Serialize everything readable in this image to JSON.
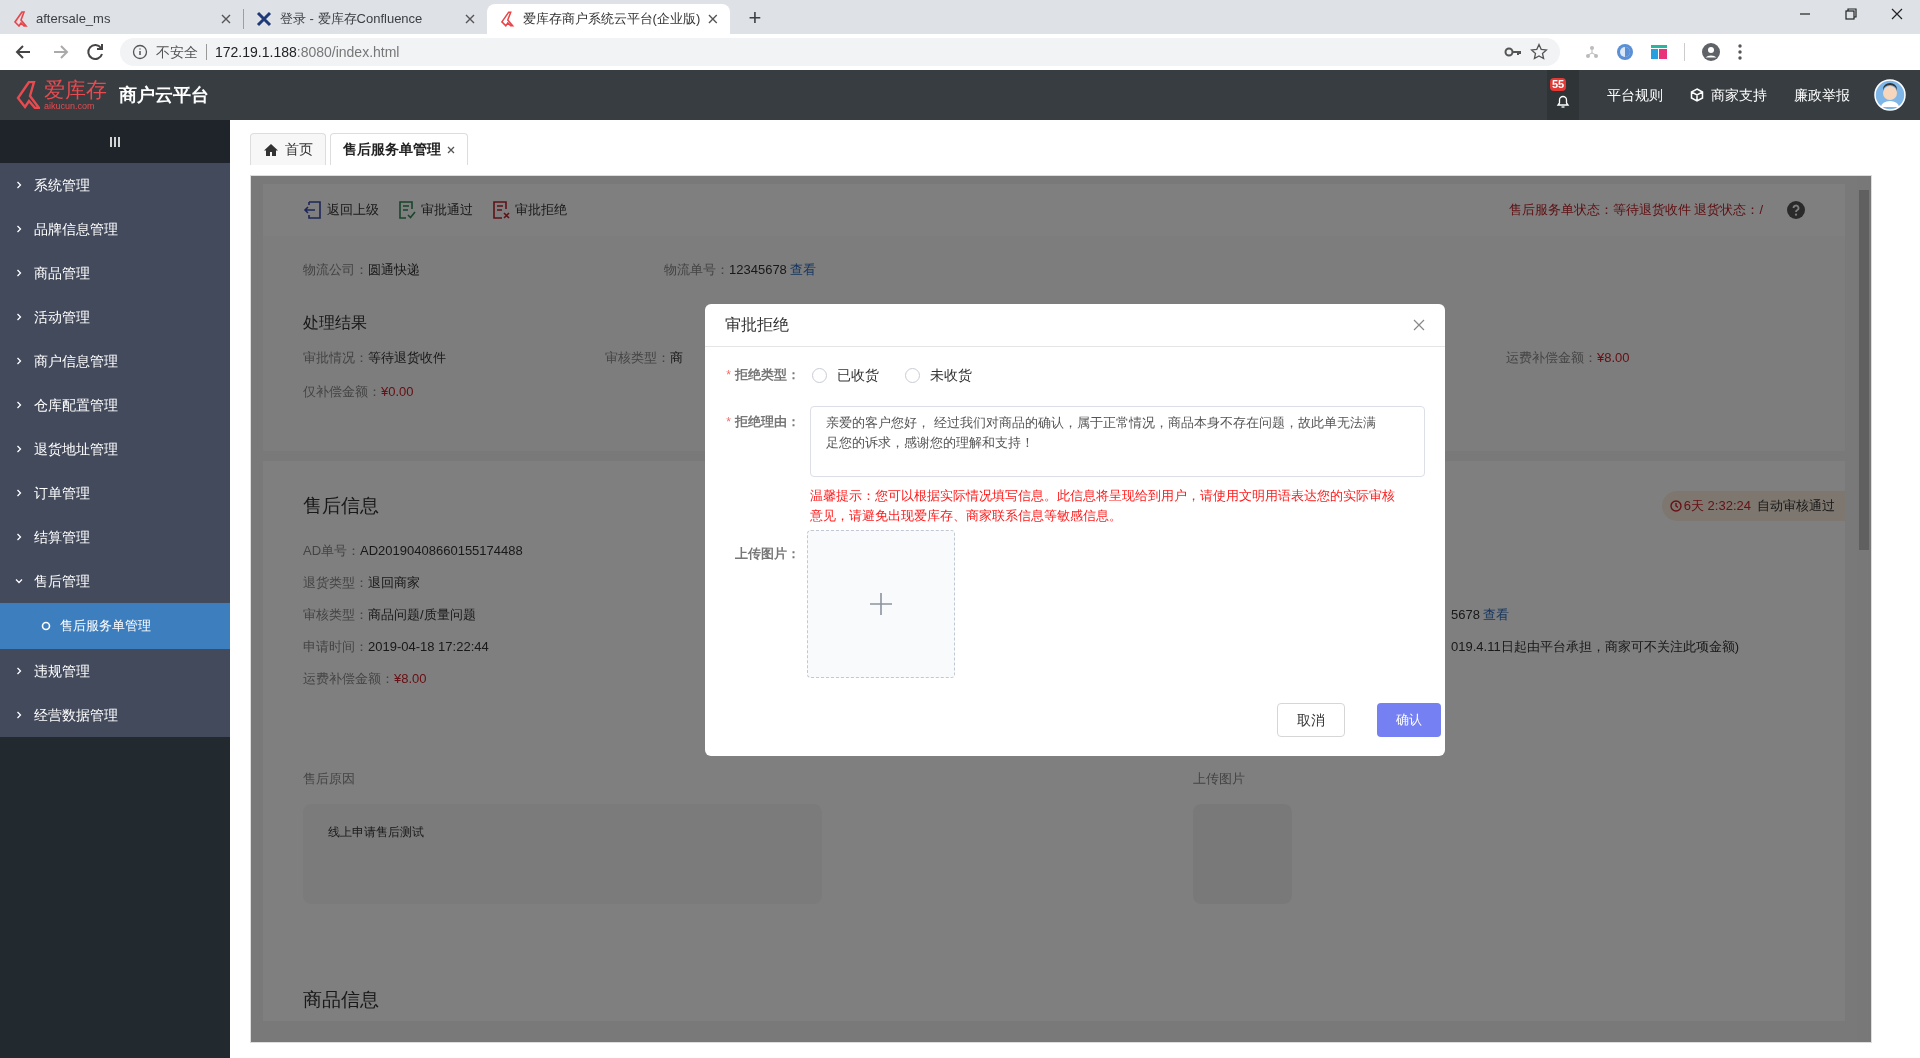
{
  "browser": {
    "tabs": [
      {
        "title": "aftersale_ms",
        "selected": false,
        "kind": "app"
      },
      {
        "title": "登录 - 爱库存Confluence",
        "selected": false,
        "kind": "wiki"
      },
      {
        "title": "爱库存商户系统云平台(企业版)",
        "selected": true,
        "kind": "app"
      }
    ],
    "new_tab": "+",
    "address": {
      "security": "不安全",
      "host": "172.19.1.188",
      "path": ":8080/index.html"
    }
  },
  "header": {
    "logo": {
      "name": "爱库存",
      "domain": "aikucun.com"
    },
    "title": "商户云平台",
    "notification_count": "55",
    "links": [
      {
        "label": "平台规则",
        "kind": "text"
      },
      {
        "label": "商家支持",
        "kind": "support"
      },
      {
        "label": "廉政举报",
        "kind": "text"
      }
    ]
  },
  "sidebar": {
    "items": [
      {
        "label": "系统管理",
        "expanded": false
      },
      {
        "label": "品牌信息管理",
        "expanded": false
      },
      {
        "label": "商品管理",
        "expanded": false
      },
      {
        "label": "活动管理",
        "expanded": false
      },
      {
        "label": "商户信息管理",
        "expanded": false
      },
      {
        "label": "仓库配置管理",
        "expanded": false
      },
      {
        "label": "退货地址管理",
        "expanded": false
      },
      {
        "label": "订单管理",
        "expanded": false
      },
      {
        "label": "结算管理",
        "expanded": false
      },
      {
        "label": "售后管理",
        "expanded": true,
        "children": [
          {
            "label": "售后服务单管理",
            "selected": true
          }
        ]
      },
      {
        "label": "违规管理",
        "expanded": false
      },
      {
        "label": "经营数据管理",
        "expanded": false
      }
    ]
  },
  "page_tabs": [
    {
      "label": "首页",
      "kind": "home",
      "selected": false
    },
    {
      "label": "售后服务单管理",
      "kind": "closable",
      "selected": true
    }
  ],
  "detail": {
    "toolbar": {
      "actions": [
        {
          "label": "返回上级",
          "kind": "back"
        },
        {
          "label": "审批通过",
          "kind": "approve"
        },
        {
          "label": "审批拒绝",
          "kind": "reject"
        }
      ],
      "status": "售后服务单状态：等待退货收件 退货状态：/"
    },
    "logistics": [
      {
        "label": "物流公司：",
        "value": "圆通快递"
      },
      {
        "label": "物流单号：",
        "value": "12345678",
        "link": "查看"
      }
    ],
    "result": {
      "title": "处理结果",
      "rows": [
        [
          {
            "label": "审批情况：",
            "value": "等待退货收件",
            "kind": "text"
          },
          {
            "label": "审核类型：",
            "value": "商",
            "kind": "text"
          },
          {
            "label": "运费补偿金额：",
            "value": "¥8.00",
            "kind": "money"
          }
        ],
        [
          {
            "label": "仅补偿金额：",
            "value": "¥0.00",
            "kind": "money"
          }
        ]
      ]
    },
    "aftersale": {
      "title": "售后信息",
      "timer": {
        "time": "6天 2:32:24",
        "label": "自动审核通过"
      },
      "fields": [
        {
          "label": "AD单号：",
          "value": "AD20190408660155174488",
          "kind": "text"
        },
        {
          "label": "退货类型：",
          "value": "退回商家",
          "kind": "text"
        },
        {
          "label": "审核类型：",
          "value": "商品问题/质量问题",
          "kind": "text"
        },
        {
          "label": "申请时间：",
          "value": "2019-04-18 17:22:44",
          "kind": "text"
        },
        {
          "label": "运费补偿金额：",
          "value": "¥8.00",
          "kind": "money"
        }
      ],
      "right_fields": [
        {
          "value": "5678",
          "link": "查看"
        },
        {
          "value": "019.4.11日起由平台承担，商家可不关注此项金额)"
        }
      ],
      "reason": {
        "label": "售后原因",
        "text": "线上申请售后测试"
      },
      "upload_label": "上传图片"
    },
    "next_section": "商品信息"
  },
  "modal": {
    "title": "审批拒绝",
    "reject_type": {
      "required_mark": "*",
      "label": "拒绝类型：",
      "options": [
        {
          "label": "已收货",
          "selected": false
        },
        {
          "label": "未收货",
          "selected": false
        }
      ]
    },
    "reason": {
      "required_mark": "*",
      "label": "拒绝理由：",
      "value": "亲爱的客户您好， 经过我们对商品的确认，属于正常情况，商品本身不存在问题，故此单无法满足您的诉求，感谢您的理解和支持！"
    },
    "hint": "温馨提示：您可以根据实际情况填写信息。此信息将呈现给到用户，请使用文明用语表达您的实际审核意见，请避免出现爱库存、商家联系信息等敏感信息。",
    "upload_label": "上传图片：",
    "buttons": [
      {
        "label": "取消",
        "kind": "secondary"
      },
      {
        "label": "确认",
        "kind": "primary"
      }
    ]
  }
}
